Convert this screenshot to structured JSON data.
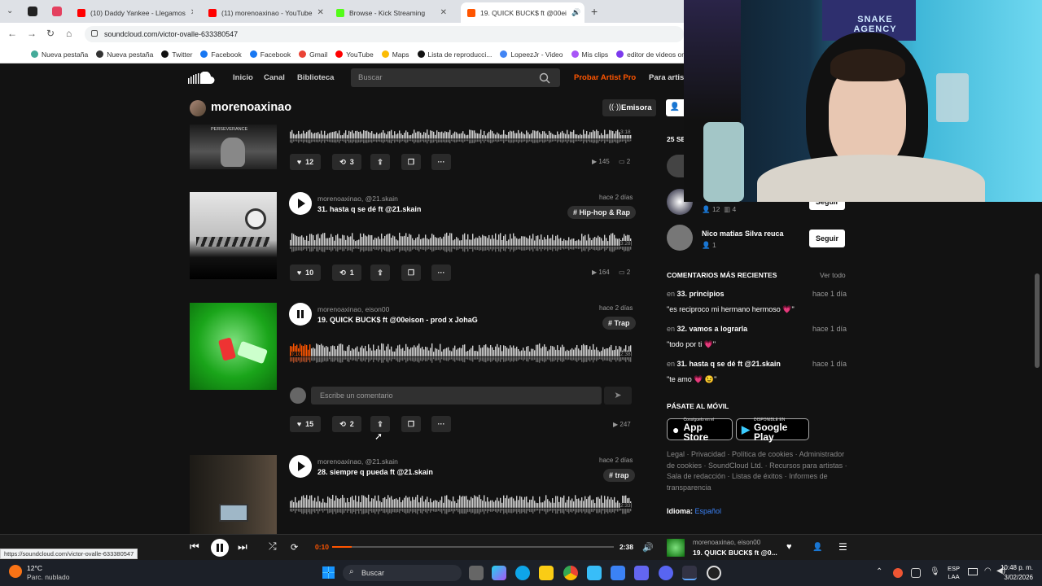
{
  "browser": {
    "tabs": [
      {
        "label": "(10) Daddy Yankee - Llegamos",
        "color": "#ff0000"
      },
      {
        "label": "(11) morenoaxinao - YouTube",
        "color": "#ff0000"
      },
      {
        "label": "Browse - Kick Streaming",
        "color": "#53fc18"
      },
      {
        "label": "19. QUICK BUCK$ ft @00ei",
        "color": "#ff5500"
      }
    ],
    "url": "soundcloud.com/victor-ovalle-633380547",
    "bookmarks": [
      {
        "label": "Nueva pestaña",
        "color": "#4a9"
      },
      {
        "label": "Nueva pestaña",
        "color": "#333"
      },
      {
        "label": "Twitter",
        "color": "#111"
      },
      {
        "label": "Facebook",
        "color": "#1877f2"
      },
      {
        "label": "Facebook",
        "color": "#1877f2"
      },
      {
        "label": "Gmail",
        "color": "#ea4335"
      },
      {
        "label": "YouTube",
        "color": "#ff0000"
      },
      {
        "label": "Maps",
        "color": "#fbbc04"
      },
      {
        "label": "Lista de reproducci...",
        "color": "#111"
      },
      {
        "label": "LopeezJr - Video",
        "color": "#4285f4"
      },
      {
        "label": "Mis clips",
        "color": "#a855f7"
      },
      {
        "label": "editor de videos onl",
        "color": "#7c3aed"
      }
    ],
    "status_url": "https://soundcloud.com/victor-ovalle-633380547"
  },
  "sc": {
    "nav": [
      "Inicio",
      "Canal",
      "Biblioteca"
    ],
    "search_placeholder": "Buscar",
    "pro": "Probar Artist Pro",
    "artists": "Para artis",
    "username": "morenoaxinao",
    "station": "Emisora",
    "accent": "#ff5500"
  },
  "tracks": [
    {
      "likes": "12",
      "reposts": "3",
      "plays": "145",
      "comments": "2",
      "time": "3:18",
      "art_label": "PERSEVERANCE"
    },
    {
      "artist": "morenoaxinao, @21.skain",
      "title": "31. hasta q se dé ft @21.skain",
      "date": "hace 2 días",
      "tag": "# Hip-hop & Rap",
      "likes": "10",
      "reposts": "1",
      "plays": "164",
      "comments": "2",
      "time": "3:28"
    },
    {
      "artist": "morenoaxinao, eison00",
      "title": "19. QUICK BUCK$ ft @00eison - prod x JohaG",
      "date": "hace 2 días",
      "tag": "# Trap",
      "likes": "15",
      "reposts": "2",
      "plays": "247",
      "elapsed": "0:10",
      "time": "2:38",
      "progress": 0.06,
      "comment_placeholder": "Escribe un comentario"
    },
    {
      "artist": "morenoaxinao, @21.skain",
      "title": "28. siempre q pueda ft @21.skain",
      "date": "hace 2 días",
      "tag": "# trap",
      "time": "2:33"
    }
  ],
  "sidebar": {
    "followers_head": "25 SE",
    "suggest1": {
      "followers": "12",
      "tracks": "4",
      "button": "Seguir"
    },
    "suggest2": {
      "name": "Nico matias Silva reuca",
      "followers": "1",
      "button": "Seguir"
    },
    "comments_head": "COMENTARIOS MÁS RECIENTES",
    "view_all": "Ver todo",
    "comments": [
      {
        "prefix": "en",
        "track": "33. principios",
        "when": "hace 1 día",
        "text": "\"es reciproco mi hermano hermoso 💗\""
      },
      {
        "prefix": "en",
        "track": "32. vamos a lograrla",
        "when": "hace 1 día",
        "text": "\"todo por ti 💗\""
      },
      {
        "prefix": "en",
        "track": "31. hasta q se dé ft @21.skain",
        "when": "hace 1 día",
        "text": "\"te amo 💗 😉\""
      }
    ],
    "mobile_head": "PÁSATE AL MÓVIL",
    "appstore_small": "Consíguelo en el",
    "appstore": "App Store",
    "gplay_small": "DISPONIBLE EN",
    "gplay": "Google Play",
    "footer": "Legal · Privacidad · Política de cookies · Administrador de cookies · SoundCloud Ltd. · Recursos para artistas · Sala de redacción · Listas de éxitos · Informes de transparencia",
    "lang_label": "Idioma:",
    "lang": "Español"
  },
  "player": {
    "elapsed": "0:10",
    "total": "2:38",
    "progress": 0.07,
    "artist": "morenoaxinao, eison00",
    "title": "19. QUICK BUCK$ ft @0..."
  },
  "taskbar": {
    "temp": "12°C",
    "weather": "Parc. nublado",
    "search": "Buscar",
    "lang1": "ESP",
    "lang2": "LAA",
    "time": "10:48 p. m.",
    "date": "3/02/2026"
  },
  "webcam": {
    "sign": "SNAKE AGENCY"
  }
}
